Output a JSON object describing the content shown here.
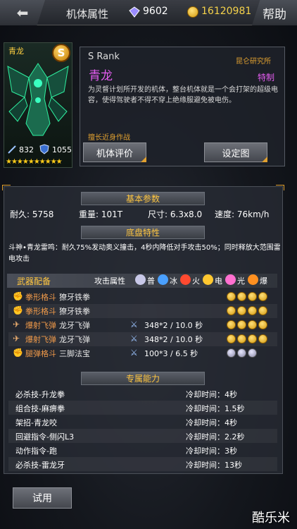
{
  "topbar": {
    "back": "⬅",
    "title": "机体属性",
    "gems": "9602",
    "coins": "16120981",
    "help": "帮助"
  },
  "mecha": {
    "name": "青龙",
    "rank_badge": "S",
    "stat1": "832",
    "stat2": "1055",
    "stars": "★★★★★★★★★★",
    "accent": "#ffcf40"
  },
  "info": {
    "rank": "S Rank",
    "lab": "昆仑研究所",
    "name": "青龙",
    "special": "特制",
    "description": "为灵督计划所开发的机体，整台机体就是一个会打架的超级电容，使得驾驶者不得不穿上绝缘服避免被电伤。",
    "fight_style": "擅长近身作战",
    "eval_btn": "机体评价",
    "setup_btn": "设定图"
  },
  "basic": {
    "header": "基本参数",
    "stats": [
      {
        "label": "耐久:",
        "value": "5758"
      },
      {
        "label": "重量:",
        "value": "101T"
      },
      {
        "label": "尺寸:",
        "value": "6.3x8.0"
      },
      {
        "label": "速度:",
        "value": "76km/h"
      }
    ]
  },
  "chassis": {
    "header": "底盘特性",
    "text": "斗神•青龙雷鸣：耐久75%发动奥义撞击，4秒内降低对手攻击50%；同时释放大范围雷电攻击"
  },
  "weapons": {
    "header": "武器配备",
    "attack_label": "攻击属性",
    "elements": [
      {
        "label": "普",
        "color": "#c8c8e8"
      },
      {
        "label": "冰",
        "color": "#4aa0ff"
      },
      {
        "label": "火",
        "color": "#ff4a30"
      },
      {
        "label": "电",
        "color": "#ffc830"
      },
      {
        "label": "光",
        "color": "#ff70d0"
      },
      {
        "label": "爆",
        "color": "#ff9020"
      }
    ],
    "rows": [
      {
        "icon": "✊",
        "type": "拳形格斗",
        "name": "獠牙铁拳",
        "value": "",
        "balls": "y"
      },
      {
        "icon": "✊",
        "type": "拳形格斗",
        "name": "獠牙铁拳",
        "value": "",
        "balls": "y"
      },
      {
        "icon": "✈",
        "type": "爆射飞弹",
        "name": "龙牙飞弹",
        "value": "348*2 / 10.0 秒",
        "balls": "y"
      },
      {
        "icon": "✈",
        "type": "爆射飞弹",
        "name": "龙牙飞弹",
        "value": "348*2 / 10.0 秒",
        "balls": "y"
      },
      {
        "icon": "✊",
        "type": "腿弹格斗",
        "name": "三脚法宝",
        "value": "100*3 / 6.5 秒",
        "balls": "g"
      }
    ]
  },
  "abilities": {
    "header": "专属能力",
    "rows": [
      {
        "name": "必杀技-升龙拳",
        "cd": "冷却时间：4秒"
      },
      {
        "name": "组合技-麻痹拳",
        "cd": "冷却时间：1.5秒"
      },
      {
        "name": "架招-青龙咬",
        "cd": "冷却时间：4秒"
      },
      {
        "name": "回避指令-侧闪L3",
        "cd": "冷却时间：2.2秒"
      },
      {
        "name": "动作指令-跑",
        "cd": "冷却时间：3秒"
      },
      {
        "name": "必杀技-雷龙牙",
        "cd": "冷却时间：13秒"
      }
    ]
  },
  "trial_btn": "试用",
  "watermark": "酷乐米"
}
